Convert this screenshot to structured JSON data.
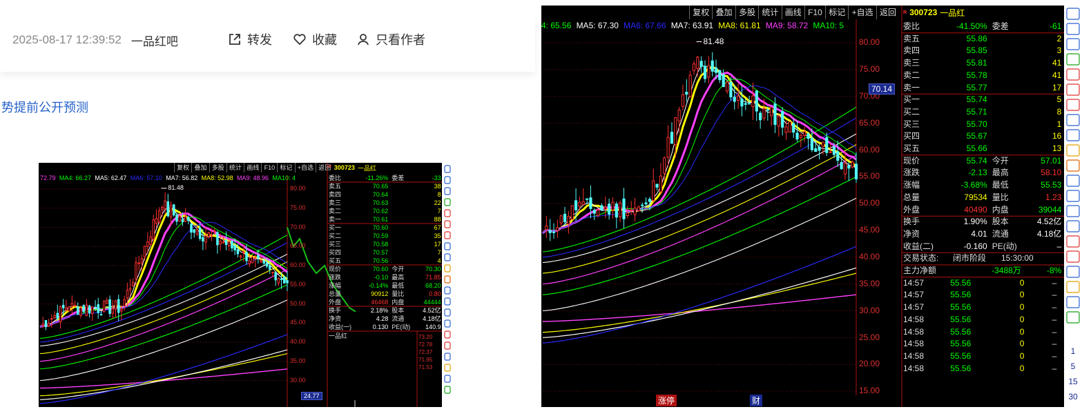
{
  "post": {
    "date": "2025-08-17 12:39:52",
    "forum": "一品红吧",
    "actions": {
      "share": "转发",
      "favorite": "收藏",
      "author_only": "只看作者"
    },
    "link_text": "势提前公开预测"
  },
  "small_chart": {
    "toolbar": [
      "复权",
      "叠加",
      "多股",
      "统计",
      "画线",
      "F10",
      "标记",
      "+自选",
      "返回"
    ],
    "ma_legend": [
      {
        "text": "72.79",
        "color": "#ff40ff"
      },
      {
        "text": "MA4: 66.27",
        "color": "#00ff00"
      },
      {
        "text": "MA5: 62.47",
        "color": "#ffffff"
      },
      {
        "text": "MA6: 57.10",
        "color": "#2a2aff"
      },
      {
        "text": "MA7: 56.82",
        "color": "#ffffff"
      },
      {
        "text": "MA8: 52.98",
        "color": "#ffff00"
      },
      {
        "text": "MA9: 48.96",
        "color": "#ff40ff"
      },
      {
        "text": "MA10: 4",
        "color": "#00ff00"
      }
    ],
    "high_label": "81.48",
    "price_axis": [
      "80.00",
      "75.00",
      "70.00",
      "65.00",
      "60.00",
      "55.00",
      "50.00",
      "45.00",
      "40.00",
      "35.00",
      "30.00"
    ],
    "price_tag": "24.77",
    "code": "300723",
    "name": "一品红",
    "weibi": {
      "label": "委比",
      "value": "-11.26%",
      "label2": "委差",
      "value2": "-33"
    },
    "asks": [
      {
        "label": "卖五",
        "price": "70.65",
        "vol": "38"
      },
      {
        "label": "卖四",
        "price": "70.64",
        "vol": "8"
      },
      {
        "label": "卖三",
        "price": "70.63",
        "vol": "22"
      },
      {
        "label": "卖二",
        "price": "70.62",
        "vol": "7"
      },
      {
        "label": "卖一",
        "price": "70.61",
        "vol": "88"
      }
    ],
    "bids": [
      {
        "label": "买一",
        "price": "70.60",
        "vol": "67"
      },
      {
        "label": "买二",
        "price": "70.59",
        "vol": "35"
      },
      {
        "label": "买三",
        "price": "70.58",
        "vol": "17"
      },
      {
        "label": "买四",
        "price": "70.57",
        "vol": "7"
      },
      {
        "label": "买五",
        "price": "70.56",
        "vol": "4"
      }
    ],
    "stats": [
      {
        "l1": "现价",
        "v1": "70.60",
        "l2": "今开",
        "v2": "70.30"
      },
      {
        "l1": "涨跌",
        "v1": "-0.10",
        "l2": "最高",
        "v2": "71.85"
      },
      {
        "l1": "涨幅",
        "v1": "-0.14%",
        "l2": "最低",
        "v2": "68.20"
      },
      {
        "l1": "总量",
        "v1": "90912",
        "l2": "量比",
        "v2": "0.80"
      },
      {
        "l1": "外盘",
        "v1": "46468",
        "l2": "内盘",
        "v2": "44444"
      }
    ],
    "stats2": [
      {
        "l1": "换手",
        "v1": "2.18%",
        "l2": "股本",
        "v2": "4.52亿"
      },
      {
        "l1": "净资",
        "v1": "4.28",
        "l2": "流通",
        "v2": "4.18亿"
      },
      {
        "l1": "收益(一)",
        "v1": "0.130",
        "l2": "PE(动)",
        "v2": "140.9"
      }
    ],
    "mini_name": "一品红",
    "mini_axis": [
      "73.20",
      "72.78",
      "72.37",
      "71.95",
      "71.53"
    ]
  },
  "large_chart": {
    "toolbar": [
      "复权",
      "叠加",
      "多股",
      "统计",
      "画线",
      "F10",
      "标记",
      "+自选",
      "返回"
    ],
    "ma_legend": [
      {
        "text": "4: 65.56",
        "color": "#00ff00"
      },
      {
        "text": "MA5: 67.30",
        "color": "#ffffff"
      },
      {
        "text": "MA6: 67.66",
        "color": "#2a2aff"
      },
      {
        "text": "MA7: 63.91",
        "color": "#ffffff"
      },
      {
        "text": "MA8: 61.81",
        "color": "#ffff00"
      },
      {
        "text": "MA9: 58.72",
        "color": "#ff40ff"
      },
      {
        "text": "MA10: 5",
        "color": "#00ff00"
      }
    ],
    "high_label": "81.48",
    "price_axis": [
      "80.00",
      "75.00",
      "70.00",
      "65.00",
      "60.00",
      "55.00",
      "50.00",
      "45.00",
      "40.00",
      "35.00",
      "30.00",
      "25.00",
      "20.00",
      "15.00"
    ],
    "price_tag": "70.14",
    "bottom_labels": [
      "涨停",
      "财"
    ],
    "code": "300723",
    "name": "一品红",
    "weibi": {
      "label": "委比",
      "value": "-41.50%",
      "label2": "委差",
      "value2": "-61"
    },
    "asks": [
      {
        "label": "卖五",
        "price": "55.86",
        "vol": "2"
      },
      {
        "label": "卖四",
        "price": "55.85",
        "vol": "3"
      },
      {
        "label": "卖三",
        "price": "55.81",
        "vol": "41"
      },
      {
        "label": "卖二",
        "price": "55.78",
        "vol": "41"
      },
      {
        "label": "卖一",
        "price": "55.77",
        "vol": "17"
      }
    ],
    "bids": [
      {
        "label": "买一",
        "price": "55.74",
        "vol": "5"
      },
      {
        "label": "买二",
        "price": "55.71",
        "vol": "8"
      },
      {
        "label": "买三",
        "price": "55.70",
        "vol": "1"
      },
      {
        "label": "买四",
        "price": "55.67",
        "vol": "16"
      },
      {
        "label": "买五",
        "price": "55.66",
        "vol": "13"
      }
    ],
    "stats": [
      {
        "l1": "现价",
        "v1": "55.74",
        "l2": "今开",
        "v2": "57.01"
      },
      {
        "l1": "涨跌",
        "v1": "-2.13",
        "l2": "最高",
        "v2": "58.10"
      },
      {
        "l1": "涨幅",
        "v1": "-3.68%",
        "l2": "最低",
        "v2": "55.53"
      },
      {
        "l1": "总量",
        "v1": "79534",
        "l2": "量比",
        "v2": "1.23"
      },
      {
        "l1": "外盘",
        "v1": "40490",
        "l2": "内盘",
        "v2": "39044"
      }
    ],
    "stats2": [
      {
        "l1": "换手",
        "v1": "1.90%",
        "l2": "股本",
        "v2": "4.52亿"
      },
      {
        "l1": "净资",
        "v1": "4.01",
        "l2": "流通",
        "v2": "4.18亿"
      },
      {
        "l1": "收益(二)",
        "v1": "-0.160",
        "l2": "PE(动)",
        "v2": "–"
      }
    ],
    "trade_status": {
      "label": "交易状态:",
      "value": "闭市阶段",
      "time": "15:30:00"
    },
    "main_flow": {
      "label": "主力净额",
      "value": "-3488万",
      "pct": "-8%"
    },
    "ticks": [
      {
        "time": "14:57",
        "price": "55.56",
        "vol": "0",
        "flag": "–"
      },
      {
        "time": "14:57",
        "price": "55.56",
        "vol": "0",
        "flag": "–"
      },
      {
        "time": "14:57",
        "price": "55.56",
        "vol": "0",
        "flag": "–"
      },
      {
        "time": "14:58",
        "price": "55.56",
        "vol": "0",
        "flag": "–"
      },
      {
        "time": "14:58",
        "price": "55.56",
        "vol": "0",
        "flag": "–"
      },
      {
        "time": "14:58",
        "price": "55.56",
        "vol": "0",
        "flag": "–"
      },
      {
        "time": "14:58",
        "price": "55.56",
        "vol": "0",
        "flag": "–"
      },
      {
        "time": "14:58",
        "price": "55.56",
        "vol": "0",
        "flag": "–"
      }
    ],
    "side_numbers": [
      "1",
      "5",
      "15",
      "30"
    ]
  }
}
